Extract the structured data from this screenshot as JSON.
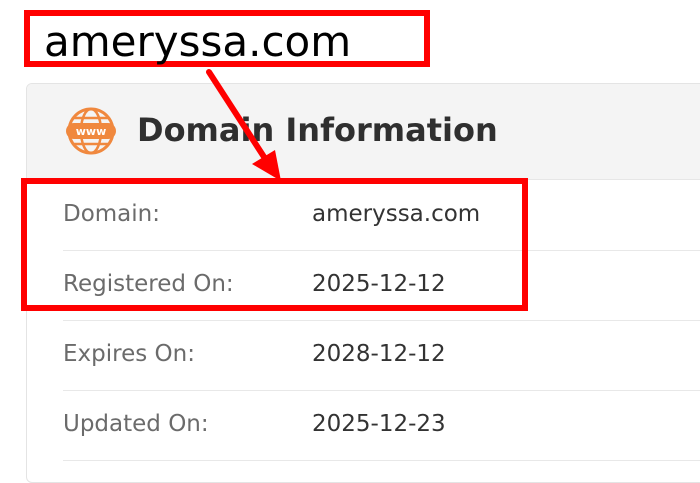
{
  "callout": {
    "domain_text": "ameryssa.com"
  },
  "card": {
    "title": "Domain Information",
    "icon": "www-globe-icon",
    "rows": [
      {
        "label": "Domain:",
        "value": "ameryssa.com"
      },
      {
        "label": "Registered On:",
        "value": "2025-12-12"
      },
      {
        "label": "Expires On:",
        "value": "2028-12-12"
      },
      {
        "label": "Updated On:",
        "value": "2025-12-23"
      }
    ]
  },
  "colors": {
    "highlight": "#ff0000",
    "icon_orange": "#f0883e",
    "header_bg": "#f4f4f4",
    "label_text": "#6b6b6b",
    "value_text": "#333333"
  }
}
